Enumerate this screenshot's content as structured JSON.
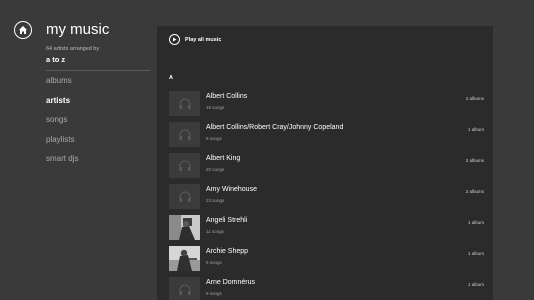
{
  "app": {
    "title": "my music",
    "subtitle": "64 artists arranged by",
    "sort": "a to z"
  },
  "nav": {
    "items": [
      {
        "label": "albums",
        "active": false
      },
      {
        "label": "artists",
        "active": true
      },
      {
        "label": "songs",
        "active": false
      },
      {
        "label": "playlists",
        "active": false
      },
      {
        "label": "smart djs",
        "active": false
      }
    ]
  },
  "panel": {
    "play_all": "Play all music",
    "section_letter": "A",
    "rows": [
      {
        "name": "Albert Collins",
        "songs": "19 songs",
        "albums": "2 albums",
        "thumb": "headphones-icon"
      },
      {
        "name": "Albert Collins/Robert Cray/Johnny Copeland",
        "songs": "9 songs",
        "albums": "1 album",
        "thumb": "headphones-icon"
      },
      {
        "name": "Albert King",
        "songs": "20 songs",
        "albums": "2 albums",
        "thumb": "headphones-icon"
      },
      {
        "name": "Amy Winehouse",
        "songs": "23 songs",
        "albums": "2 albums",
        "thumb": "headphones-icon"
      },
      {
        "name": "Angeli Strehli",
        "songs": "11 songs",
        "albums": "1 album",
        "thumb": "artist-photo"
      },
      {
        "name": "Archie Shepp",
        "songs": "5 songs",
        "albums": "1 album",
        "thumb": "artist-photo"
      },
      {
        "name": "Arne Domnérus",
        "songs": "9 songs",
        "albums": "1 album",
        "thumb": "headphones-icon"
      }
    ]
  },
  "colors": {
    "background": "#3a3a3a",
    "panel": "#2b2b2b",
    "thumb": "#3b3b3b",
    "text_muted": "#a9a9a9"
  }
}
